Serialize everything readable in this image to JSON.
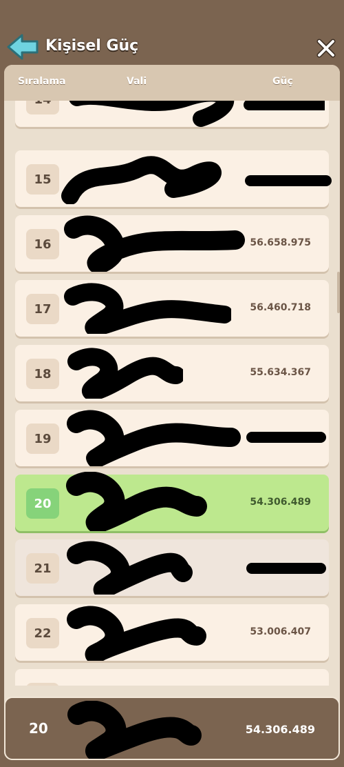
{
  "header": {
    "title": "Kişisel Güç"
  },
  "columns": {
    "rank": "Sıralama",
    "governor": "Vali",
    "power": "Güç"
  },
  "rows": [
    {
      "rank": "14",
      "power": ""
    },
    {
      "rank": "15",
      "power": ""
    },
    {
      "rank": "16",
      "power": "56.658.975"
    },
    {
      "rank": "17",
      "power": "56.460.718"
    },
    {
      "rank": "18",
      "power": "55.634.367"
    },
    {
      "rank": "19",
      "power": ""
    },
    {
      "rank": "20",
      "power": "54.306.489"
    },
    {
      "rank": "21",
      "power": ""
    },
    {
      "rank": "22",
      "power": "53.006.407"
    },
    {
      "rank": "",
      "power": ""
    }
  ],
  "self": {
    "rank": "20",
    "power": "54.306.489"
  },
  "colors": {
    "highlight": "#bde88e",
    "panel": "#eadfcf",
    "frame": "#7b6450"
  }
}
